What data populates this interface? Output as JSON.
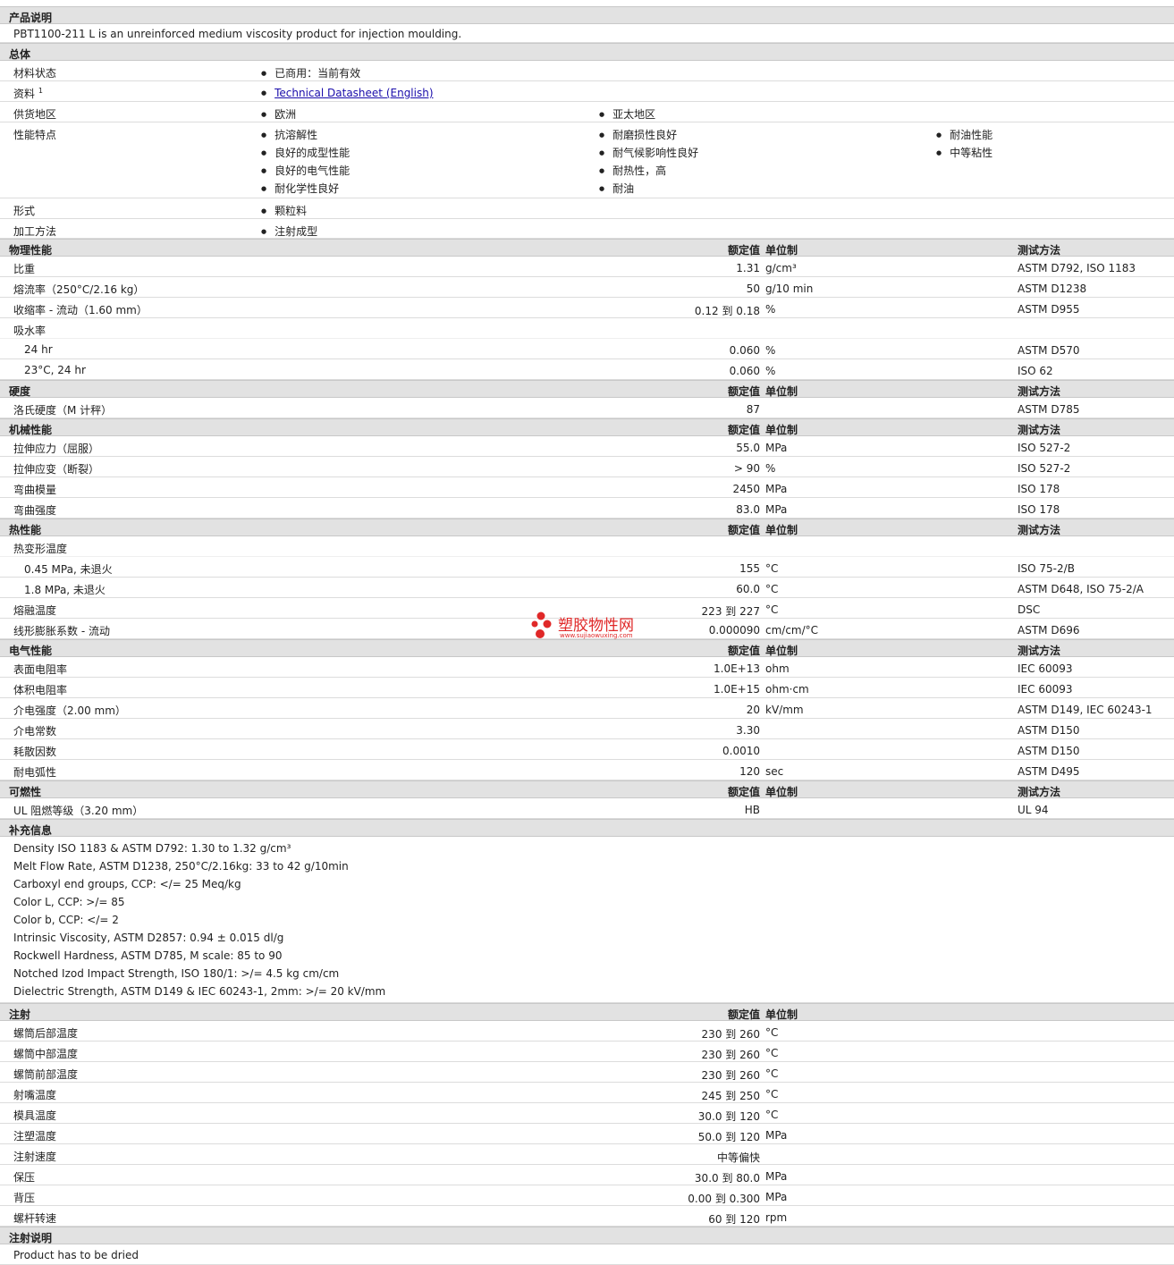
{
  "description": {
    "header": "产品说明",
    "text": "PBT1100-211 L is an unreinforced medium viscosity product for injection moulding."
  },
  "general": {
    "header": "总体",
    "material_status_label": "材料状态",
    "material_status_value": "已商用：当前有效",
    "data_label": "资料",
    "data_sup": "1",
    "data_link": "Technical Datasheet (English)",
    "region_label": "供货地区",
    "region_1": "欧洲",
    "region_2": "亚太地区",
    "features_label": "性能特点",
    "features": [
      "抗溶解性",
      "耐磨损性良好",
      "耐油性能",
      "良好的成型性能",
      "耐气候影响性良好",
      "中等粘性",
      "良好的电气性能",
      "耐热性，高",
      "耐化学性良好",
      "耐油"
    ],
    "form_label": "形式",
    "form_value": "颗粒料",
    "process_label": "加工方法",
    "process_value": "注射成型"
  },
  "col_headers": {
    "value": "额定值",
    "unit": "单位制",
    "method": "测试方法"
  },
  "physical": {
    "header": "物理性能",
    "rows": [
      {
        "name": "比重",
        "value": "1.31",
        "unit": "g/cm³",
        "method": "ASTM D792, ISO 1183"
      },
      {
        "name": "熔流率（250°C/2.16 kg）",
        "value": "50",
        "unit": "g/10 min",
        "method": "ASTM D1238"
      },
      {
        "name": "收缩率 - 流动（1.60 mm）",
        "value": "0.12 到  0.18",
        "unit": "%",
        "method": "ASTM D955"
      },
      {
        "name": "吸水率",
        "value": "",
        "unit": "",
        "method": ""
      },
      {
        "name": "24 hr",
        "value": "0.060",
        "unit": "%",
        "method": "ASTM D570"
      },
      {
        "name": "23°C, 24 hr",
        "value": "0.060",
        "unit": "%",
        "method": "ISO 62"
      }
    ]
  },
  "hardness": {
    "header": "硬度",
    "rows": [
      {
        "name": "洛氏硬度（M 计秤）",
        "value": "87",
        "unit": "",
        "method": "ASTM D785"
      }
    ]
  },
  "mechanical": {
    "header": "机械性能",
    "rows": [
      {
        "name": "拉伸应力（屈服）",
        "value": "55.0",
        "unit": "MPa",
        "method": "ISO 527-2"
      },
      {
        "name": "拉伸应变（断裂）",
        "value": "> 90",
        "unit": "%",
        "method": "ISO 527-2"
      },
      {
        "name": "弯曲模量",
        "value": "2450",
        "unit": "MPa",
        "method": "ISO 178"
      },
      {
        "name": "弯曲强度",
        "value": "83.0",
        "unit": "MPa",
        "method": "ISO 178"
      }
    ]
  },
  "thermal": {
    "header": "热性能",
    "rows": [
      {
        "name": "热变形温度",
        "value": "",
        "unit": "",
        "method": ""
      },
      {
        "name": "0.45 MPa, 未退火",
        "value": "155",
        "unit": "°C",
        "method": "ISO 75-2/B"
      },
      {
        "name": "1.8 MPa, 未退火",
        "value": "60.0",
        "unit": "°C",
        "method": "ASTM D648, ISO 75-2/A"
      },
      {
        "name": "熔融温度",
        "value": "223 到  227",
        "unit": "°C",
        "method": "DSC"
      },
      {
        "name": "线形膨胀系数 - 流动",
        "value": "0.000090",
        "unit": "cm/cm/°C",
        "method": "ASTM D696"
      }
    ]
  },
  "electrical": {
    "header": "电气性能",
    "rows": [
      {
        "name": "表面电阻率",
        "value": "1.0E+13",
        "unit": "ohm",
        "method": "IEC 60093"
      },
      {
        "name": "体积电阻率",
        "value": "1.0E+15",
        "unit": "ohm·cm",
        "method": "IEC 60093"
      },
      {
        "name": "介电强度（2.00 mm）",
        "value": "20",
        "unit": "kV/mm",
        "method": "ASTM D149, IEC 60243-1"
      },
      {
        "name": "介电常数",
        "value": "3.30",
        "unit": "",
        "method": "ASTM D150"
      },
      {
        "name": "耗散因数",
        "value": "0.0010",
        "unit": "",
        "method": "ASTM D150"
      },
      {
        "name": "耐电弧性",
        "value": "120",
        "unit": "sec",
        "method": "ASTM D495"
      }
    ]
  },
  "flammability": {
    "header": "可燃性",
    "rows": [
      {
        "name": "UL 阻燃等级（3.20 mm）",
        "value": "HB",
        "unit": "",
        "method": "UL 94"
      }
    ]
  },
  "supplemental": {
    "header": "补充信息",
    "lines": [
      "Density ISO 1183 & ASTM D792: 1.30 to 1.32 g/cm³",
      "Melt Flow Rate, ASTM D1238, 250°C/2.16kg: 33 to 42 g/10min",
      "Carboxyl end groups, CCP: </= 25 Meq/kg",
      "Color L, CCP: >/= 85",
      "Color b, CCP: </= 2",
      "Intrinsic Viscosity, ASTM D2857: 0.94 ± 0.015 dl/g",
      "Rockwell Hardness, ASTM D785, M scale: 85 to 90",
      "Notched Izod Impact Strength, ISO 180/1: >/= 4.5 kg cm/cm",
      "Dielectric Strength, ASTM D149 & IEC 60243-1, 2mm: >/= 20 kV/mm"
    ]
  },
  "injection": {
    "header": "注射",
    "rows": [
      {
        "name": "螺筒后部温度",
        "value": "230 到  260",
        "unit": "°C"
      },
      {
        "name": "螺筒中部温度",
        "value": "230 到  260",
        "unit": "°C"
      },
      {
        "name": "螺筒前部温度",
        "value": "230 到  260",
        "unit": "°C"
      },
      {
        "name": "射嘴温度",
        "value": "245 到  250",
        "unit": "°C"
      },
      {
        "name": "模具温度",
        "value": "30.0 到  120",
        "unit": "°C"
      },
      {
        "name": "注塑温度",
        "value": "50.0 到  120",
        "unit": "MPa"
      },
      {
        "name": "注射速度",
        "value": "中等偏快",
        "unit": ""
      },
      {
        "name": "保压",
        "value": "30.0 到  80.0",
        "unit": "MPa"
      },
      {
        "name": "背压",
        "value": "0.00 到  0.300",
        "unit": "MPa"
      },
      {
        "name": "螺杆转速",
        "value": "60 到  120",
        "unit": "rpm"
      }
    ]
  },
  "injection_notes": {
    "header": "注射说明",
    "text": "Product has to be dried"
  },
  "watermark": {
    "name": "塑胶物性网",
    "url": "www.sujiaowuxing.com",
    "color": "#e02828"
  }
}
